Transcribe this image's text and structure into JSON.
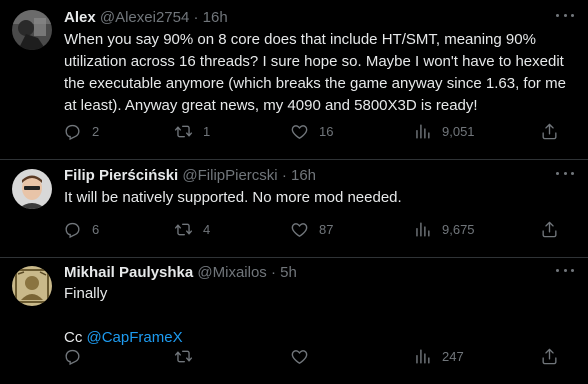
{
  "tweets": [
    {
      "name": "Alex",
      "handle": "@Alexei2754",
      "separator": "·",
      "time": "16h",
      "text": "When you say 90% on 8 core does that include HT/SMT, meaning 90% utilization across 16 threads? I sure hope so. Maybe I won't have to hexedit the executable anymore (which breaks the game anyway since 1.63, for me at least). Anyway great news, my 4090 and 5800X3D is ready!",
      "replies": "2",
      "retweets": "1",
      "likes": "16",
      "views": "9,051"
    },
    {
      "name": "Filip Pierściński",
      "handle": "@FilipPiercski",
      "separator": "·",
      "time": "16h",
      "text": "It will be natively supported. No more mod needed.",
      "replies": "6",
      "retweets": "4",
      "likes": "87",
      "views": "9,675"
    },
    {
      "name": "Mikhail Paulyshka",
      "handle": "@Mixailos",
      "separator": "·",
      "time": "5h",
      "text_line1": "Finally",
      "text_prefix": "Cc ",
      "mention": "@CapFrameX",
      "replies": "",
      "retweets": "",
      "likes": "",
      "views": "247"
    }
  ],
  "icons": {
    "reply": "reply-icon",
    "retweet": "retweet-icon",
    "like": "heart-icon",
    "views": "views-icon",
    "share": "share-icon",
    "more": "more-icon"
  },
  "colors": {
    "background": "#000000",
    "text": "#e7e9ea",
    "muted": "#71767b",
    "link": "#1d9bf0",
    "divider": "#2f3336"
  }
}
